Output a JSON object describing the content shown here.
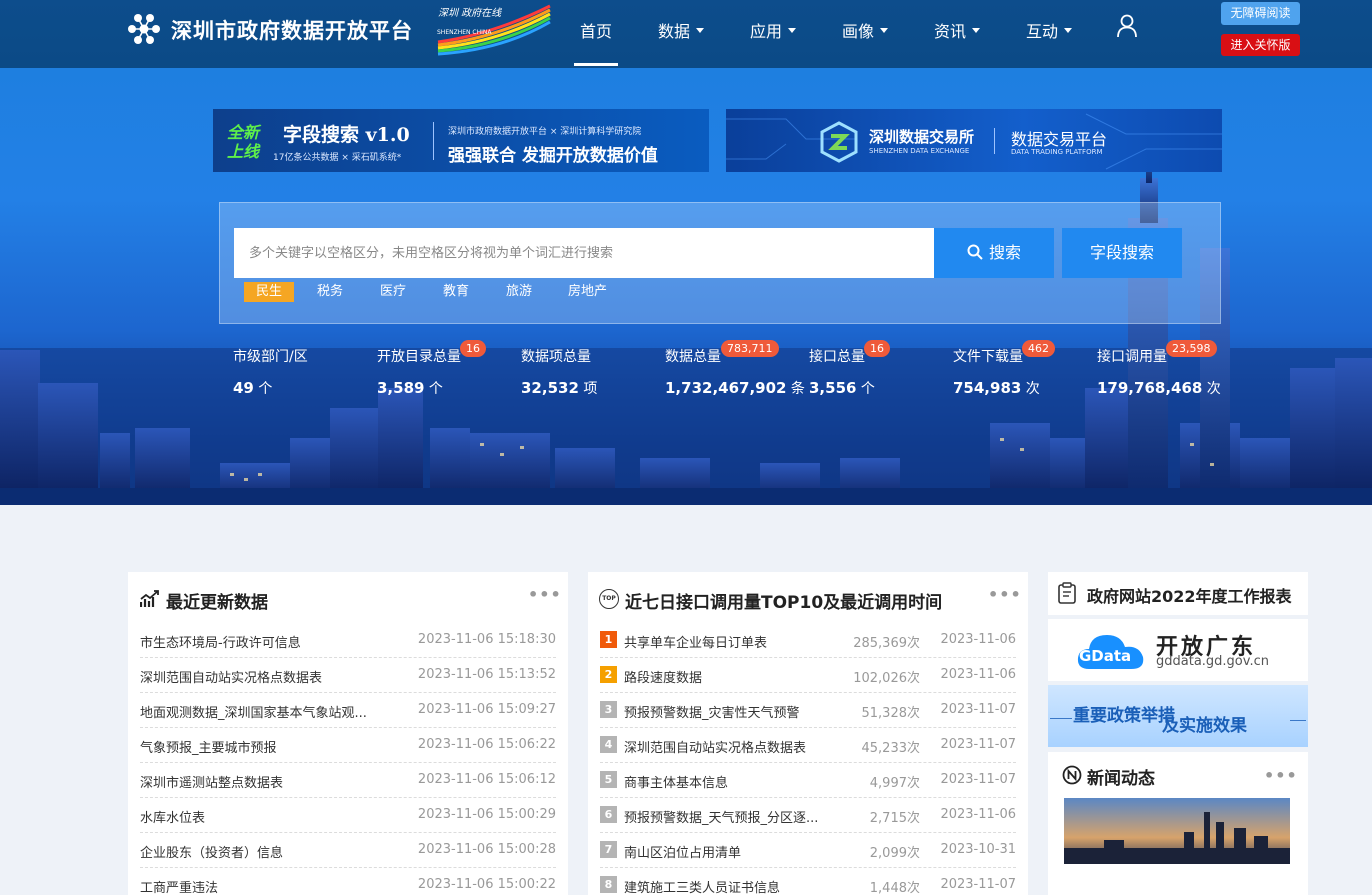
{
  "header": {
    "site_title": "深圳市政府数据开放平台",
    "brand_top": "深圳 政府在线",
    "brand_bottom": "SHENZHEN CHINA",
    "nav": [
      {
        "label": "首页",
        "active": true
      },
      {
        "label": "数据",
        "dropdown": true
      },
      {
        "label": "应用",
        "dropdown": true
      },
      {
        "label": "画像",
        "dropdown": true
      },
      {
        "label": "资讯",
        "dropdown": true
      },
      {
        "label": "互动",
        "dropdown": true
      }
    ],
    "accessibility_label": "无障碍阅读",
    "care_mode_label": "进入关怀版"
  },
  "banners": {
    "field_search": {
      "badge": "全新上线",
      "title": "字段搜索 v1.0",
      "subtitle": "17亿条公共数据 × 采石矶系统*",
      "orgs": "深圳市政府数据开放平台 × 深圳计算科学研究院",
      "slogan": "强强联合 发掘开放数据价值"
    },
    "exchange": {
      "name": "深圳数据交易所",
      "name_en": "SHENZHEN DATA EXCHANGE",
      "platform": "数据交易平台",
      "platform_en": "DATA TRADING PLATFORM"
    }
  },
  "search": {
    "placeholder": "多个关键字以空格区分，未用空格区分将视为单个词汇进行搜索",
    "search_label": "搜索",
    "field_search_label": "字段搜索",
    "tags": [
      {
        "label": "民生",
        "active": true
      },
      {
        "label": "税务"
      },
      {
        "label": "医疗"
      },
      {
        "label": "教育"
      },
      {
        "label": "旅游"
      },
      {
        "label": "房地产"
      }
    ]
  },
  "stats": [
    {
      "label": "市级部门/区",
      "value": "49",
      "unit": "个",
      "badge": ""
    },
    {
      "label": "开放目录总量",
      "value": "3,589",
      "unit": "个",
      "badge": "16"
    },
    {
      "label": "数据项总量",
      "value": "32,532",
      "unit": "项",
      "badge": ""
    },
    {
      "label": "数据总量",
      "value": "1,732,467,902",
      "unit": "条",
      "badge": "783,711"
    },
    {
      "label": "接口总量",
      "value": "3,556",
      "unit": "个",
      "badge": "16"
    },
    {
      "label": "文件下载量",
      "value": "754,983",
      "unit": "次",
      "badge": "462"
    },
    {
      "label": "接口调用量",
      "value": "179,768,468",
      "unit": "次",
      "badge": "23,598"
    }
  ],
  "recent": {
    "title": "最近更新数据",
    "more": "•••",
    "items": [
      {
        "name": "市生态环境局-行政许可信息",
        "time": "2023-11-06 15:18:30"
      },
      {
        "name": "深圳范围自动站实况格点数据表",
        "time": "2023-11-06 15:13:52"
      },
      {
        "name": "地面观测数据_深圳国家基本气象站观...",
        "time": "2023-11-06 15:09:27"
      },
      {
        "name": "气象预报_主要城市预报",
        "time": "2023-11-06 15:06:22"
      },
      {
        "name": "深圳市遥测站整点数据表",
        "time": "2023-11-06 15:06:12"
      },
      {
        "name": "水库水位表",
        "time": "2023-11-06 15:00:29"
      },
      {
        "name": "企业股东（投资者）信息",
        "time": "2023-11-06 15:00:28"
      },
      {
        "name": "工商严重违法",
        "time": "2023-11-06 15:00:22"
      }
    ]
  },
  "top10": {
    "title": "近七日接口调用量TOP10及最近调用时间",
    "badge": "TOP",
    "more": "•••",
    "items": [
      {
        "rank": "1",
        "name": "共享单车企业每日订单表",
        "count": "285,369次",
        "date": "2023-11-06"
      },
      {
        "rank": "2",
        "name": "路段速度数据",
        "count": "102,026次",
        "date": "2023-11-06"
      },
      {
        "rank": "3",
        "name": "预报预警数据_灾害性天气预警",
        "count": "51,328次",
        "date": "2023-11-07"
      },
      {
        "rank": "4",
        "name": "深圳范围自动站实况格点数据表",
        "count": "45,233次",
        "date": "2023-11-07"
      },
      {
        "rank": "5",
        "name": "商事主体基本信息",
        "count": "4,997次",
        "date": "2023-11-07"
      },
      {
        "rank": "6",
        "name": "预报预警数据_天气预报_分区逐...",
        "count": "2,715次",
        "date": "2023-11-06"
      },
      {
        "rank": "7",
        "name": "南山区泊位占用清单",
        "count": "2,099次",
        "date": "2023-10-31"
      },
      {
        "rank": "8",
        "name": "建筑施工三类人员证书信息",
        "count": "1,448次",
        "date": "2023-11-07"
      }
    ]
  },
  "sidebar": {
    "report_title": "政府网站2022年度工作报表",
    "gdata_badge": "GData",
    "gdata_title": "开放广东",
    "gdata_url": "gddata.gd.gov.cn",
    "policy_a": "重要政策举措",
    "policy_b": "及实施效果",
    "news_title": "新闻动态",
    "news_more": "•••"
  },
  "colors": {
    "header_bg": "#0d4d8c",
    "accent_blue": "#2189f0",
    "care_red": "#d90f14",
    "badge_red": "#ef5a3a",
    "tag_orange": "#f5a623",
    "rank1": "#f05a0a",
    "rank2": "#f5a000",
    "rank_other": "#b4b4b4"
  }
}
